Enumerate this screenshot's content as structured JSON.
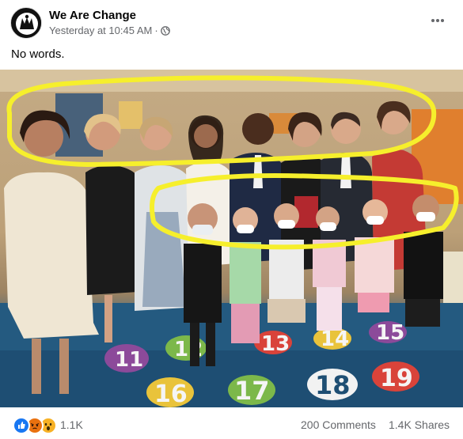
{
  "post": {
    "page_name": "We Are Change",
    "timestamp": "Yesterday at 10:45 AM",
    "separator": "·",
    "audience_icon": "globe-icon",
    "more_icon": "ellipsis-icon",
    "caption": "No words."
  },
  "photo": {
    "rug_numbers": [
      "11",
      "12",
      "13",
      "14",
      "15",
      "16",
      "17",
      "18",
      "19"
    ],
    "highlight_color": "#f6ef2c"
  },
  "footer": {
    "reaction_icons": [
      "like-icon",
      "angry-icon",
      "wow-icon"
    ],
    "reaction_count": "1.1K",
    "comments": "200 Comments",
    "shares": "1.4K Shares"
  },
  "colors": {
    "like": "#1877f2",
    "angry": "#e9710f",
    "wow": "#f7b125",
    "secondary_text": "#65676b"
  }
}
